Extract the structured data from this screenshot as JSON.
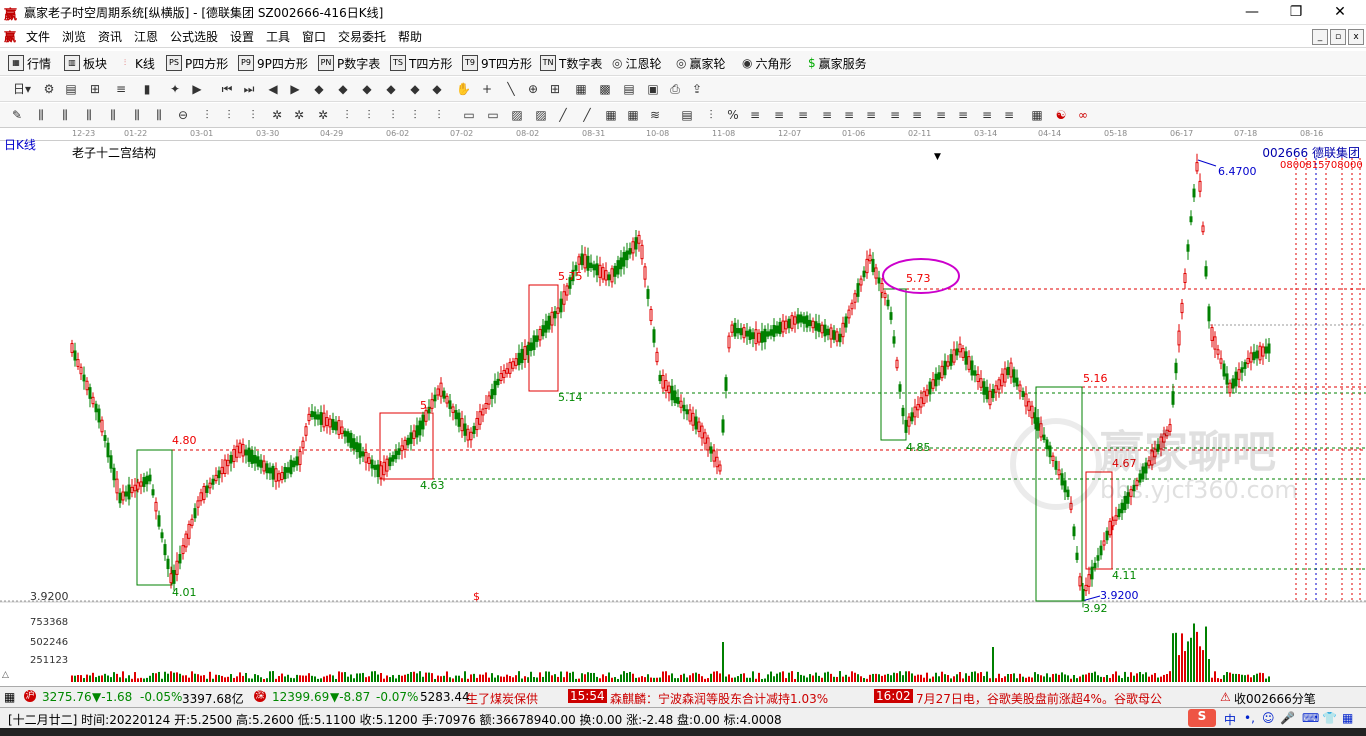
{
  "window": {
    "app_icon": "赢",
    "title": "赢家老子时空周期系统[纵横版] - [德联集团  SZ002666-416日K线]",
    "min": "—",
    "max": "❐",
    "close": "✕"
  },
  "menu": {
    "items": [
      "文件",
      "浏览",
      "资讯",
      "江恩",
      "公式选股",
      "设置",
      "工具",
      "窗口",
      "交易委托",
      "帮助"
    ]
  },
  "toolbar1": {
    "items": [
      "行情",
      "板块",
      "K线",
      "P四方形",
      "9P四方形",
      "P数字表",
      "T四方形",
      "9T四方形",
      "T数字表",
      "江恩轮",
      "赢家轮",
      "六角形",
      "赢家服务"
    ],
    "icons": [
      "PS",
      "P9",
      "PN",
      "TS",
      "T9",
      "TN"
    ]
  },
  "toolbar2": {
    "period": "日"
  },
  "chart": {
    "tag": "日K线",
    "indicator": "老子十二宫结构",
    "code": "002666",
    "name": "德联集团",
    "dates": [
      "12-23",
      "01-22",
      "03-01",
      "03-30",
      "04-29",
      "06-02",
      "07-02",
      "08-02",
      "08-31",
      "10-08",
      "11-08",
      "12-07",
      "01-06",
      "02-11",
      "03-14",
      "04-14",
      "05-18",
      "06-17",
      "07-18",
      "08-16"
    ],
    "right_dates": "0800815708000",
    "price_labels": {
      "p480": "4.80",
      "p401": "4.01",
      "p5x": "5.",
      "p463": "4.63",
      "p575": "5.75",
      "p514": "5.14",
      "p573": "5.73",
      "p485": "4.85",
      "p516": "5.16",
      "p467": "4.67",
      "p411": "4.11",
      "p392": "3.92",
      "p39200": "3.9200",
      "p64700": "6.4700"
    },
    "low_price": "3.9200",
    "dollar": "$",
    "volume_ticks": [
      "753368",
      "502246",
      "251123"
    ],
    "watermark": "赢家聊吧",
    "watermark_url": "bbs.yjcf360.com"
  },
  "status1": {
    "sh_index": "3275.76",
    "sh_change": "▼-1.68",
    "sh_pct": "-0.05%",
    "sh_amount": "3397.68亿",
    "sz_index": "12399.69",
    "sz_change": "▼-8.87",
    "sz_pct": "-0.07%",
    "sz_amount": "5283.44",
    "news1": "生了煤炭保供",
    "time1": "15:54",
    "news2": "森麒麟：宁波森润等股东合计减持1.03%",
    "time2": "16:02",
    "news3": "7月27日电，谷歌美股盘前涨超4%。谷歌母公",
    "right": "收002666分笔"
  },
  "status2": {
    "text": "[十二月廿二] 时间:20220124 开:5.2500 高:5.2600 低:5.1100 收:5.1200 手:70976 额:36678940.00 换:0.00 涨:-2.48 盘:0.00 标:4.0008"
  },
  "colors": {
    "up": "#e00000",
    "down": "#008000",
    "accent": "#cc00cc",
    "blue": "#0000cc"
  }
}
